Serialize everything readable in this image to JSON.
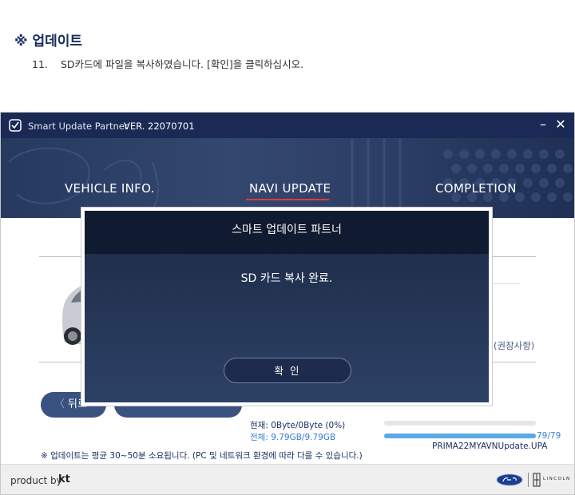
{
  "doc": {
    "heading": "※ 업데이트",
    "step_number": "11.",
    "step_text": "SD카드에 파일을 복사하였습니다. [확인]을 클릭하십시오."
  },
  "app": {
    "name": "Smart Update Partner",
    "version": "VER. 22070701",
    "minimize_label": "–",
    "close_label": "✕",
    "tabs": [
      "VEHICLE INFO.",
      "NAVI UPDATE",
      "COMPLETION"
    ],
    "active_tab": "NAVI UPDATE",
    "recommend_note": "(권장사항)",
    "back_button": {
      "chevron": "〈",
      "label": "뒤로"
    },
    "stats": {
      "current": "현재: 0Byte/0Byte (0%)",
      "total": "전체: 9.79GB/9.79GB"
    },
    "progress": {
      "current_fraction": 0.0,
      "total_fraction": 1.0
    },
    "file_count": "79/79",
    "filename": "PRIMA22MYAVNUpdate.UPA",
    "note": "※ 업데이트는 평균 30~50분 소요됩니다. (PC 및 네트워크 환경에 따라 다를 수 있습니다.)",
    "footer": {
      "product_by": "product by",
      "kt": "kt",
      "lincoln": "LINCOLN"
    },
    "colors": {
      "accent": "#1b2a55",
      "underline": "#e53a3a",
      "progress": "#5ba9e8"
    }
  },
  "modal": {
    "title": "스마트 업데이트 파트너",
    "message": "SD 카드 복사 완료.",
    "ok_label": "확 인"
  }
}
